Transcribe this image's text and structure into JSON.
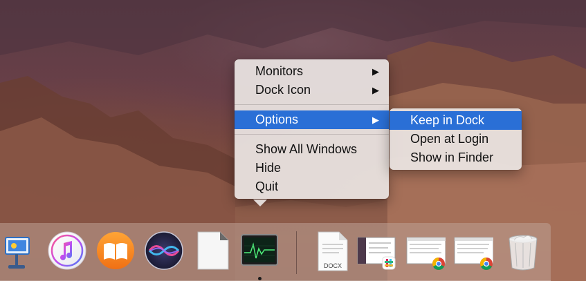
{
  "context_menu": {
    "items": [
      {
        "label": "Monitors",
        "has_submenu": true
      },
      {
        "label": "Dock Icon",
        "has_submenu": true
      },
      {
        "label": "Options",
        "has_submenu": true,
        "highlighted": true
      },
      {
        "label": "Show All Windows"
      },
      {
        "label": "Hide"
      },
      {
        "label": "Quit"
      }
    ],
    "submenu_arrow": "▶"
  },
  "options_submenu": {
    "items": [
      {
        "label": "Keep in Dock",
        "highlighted": true
      },
      {
        "label": "Open at Login"
      },
      {
        "label": "Show in Finder"
      }
    ]
  },
  "dock": {
    "apps": [
      {
        "name": "keynote-icon"
      },
      {
        "name": "itunes-icon"
      },
      {
        "name": "ibooks-icon"
      },
      {
        "name": "siri-icon"
      },
      {
        "name": "document-icon"
      },
      {
        "name": "activity-monitor-icon",
        "running": true
      }
    ],
    "docx_label": "DOCX",
    "thumbnails": [
      {
        "name": "slack-window-thumbnail"
      },
      {
        "name": "chrome-window-thumbnail-1"
      },
      {
        "name": "chrome-window-thumbnail-2"
      }
    ],
    "trash": {
      "name": "trash-icon"
    }
  },
  "colors": {
    "highlight": "#2a6fd6",
    "menu_bg": "#ece6e4"
  }
}
